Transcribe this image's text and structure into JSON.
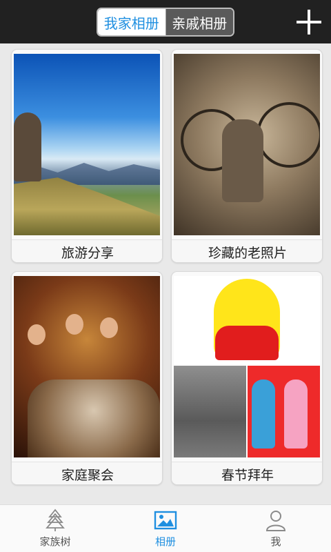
{
  "header": {
    "tabs": [
      {
        "label": "我家相册",
        "active": true
      },
      {
        "label": "亲戚相册",
        "active": false
      }
    ],
    "add_icon": "plus-icon"
  },
  "albums": [
    {
      "title": "旅游分享"
    },
    {
      "title": "珍藏的老照片"
    },
    {
      "title": "家庭聚会"
    },
    {
      "title": "春节拜年"
    }
  ],
  "bottom_nav": {
    "items": [
      {
        "label": "家族树",
        "icon": "tree-icon",
        "active": false
      },
      {
        "label": "相册",
        "icon": "image-icon",
        "active": true
      },
      {
        "label": "我",
        "icon": "person-icon",
        "active": false
      }
    ]
  },
  "colors": {
    "accent": "#1f8fe0",
    "topbar": "#212121",
    "background": "#e9e9e9"
  }
}
